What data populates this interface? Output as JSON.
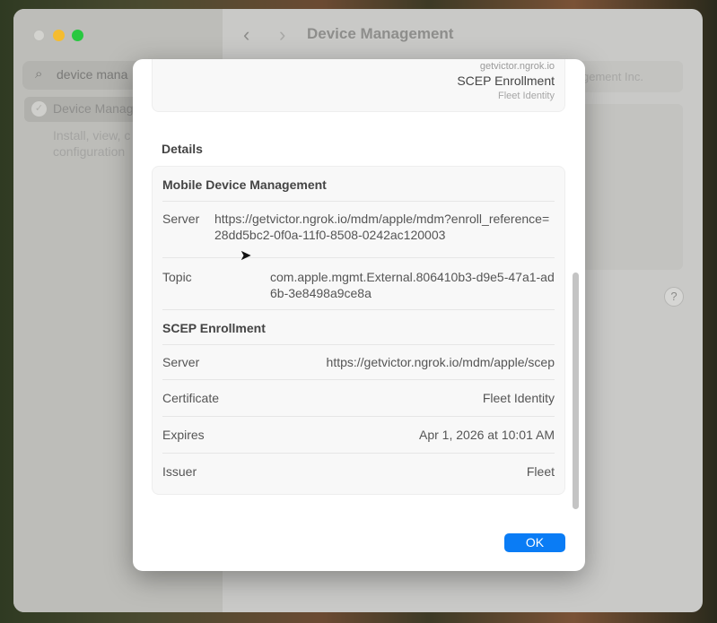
{
  "window": {
    "title": "Device Management",
    "search_value": "device mana",
    "sidebar_item": "Device Manag",
    "sidebar_desc_lines": [
      "Install, view, c",
      "configuration"
    ],
    "right_partial_text": "gement Inc.",
    "help_label": "?"
  },
  "dialog": {
    "top_card": {
      "host": "getvictor.ngrok.io",
      "title": "SCEP Enrollment",
      "subtitle": "Fleet Identity"
    },
    "details_heading": "Details",
    "mdm": {
      "heading": "Mobile Device Management",
      "server_label": "Server",
      "server_value": "https://getvictor.ngrok.io/mdm/apple/mdm?enroll_reference=28dd5bc2-0f0a-11f0-8508-0242ac120003",
      "topic_label": "Topic",
      "topic_value": "com.apple.mgmt.External.806410b3-d9e5-47a1-ad6b-3e8498a9ce8a"
    },
    "scep": {
      "heading": "SCEP Enrollment",
      "rows": [
        {
          "label": "Server",
          "value": "https://getvictor.ngrok.io/mdm/apple/scep"
        },
        {
          "label": "Certificate",
          "value": "Fleet Identity"
        },
        {
          "label": "Expires",
          "value": "Apr 1, 2026 at 10:01 AM"
        },
        {
          "label": "Issuer",
          "value": "Fleet"
        }
      ]
    },
    "ok_label": "OK"
  }
}
